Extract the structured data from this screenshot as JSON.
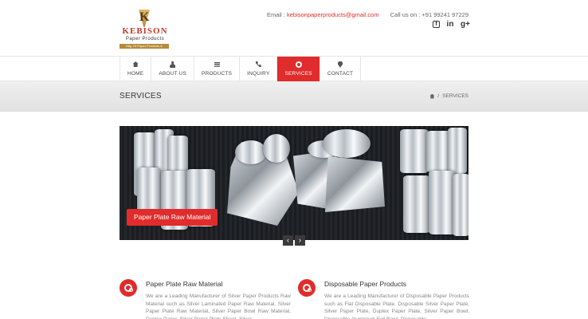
{
  "header": {
    "logo": {
      "name": "KEBISON",
      "tagline": "Paper Products",
      "strip": "Mfg. Of Paper Products & Aluminium"
    },
    "email_label": "Email :",
    "email": "kebisonpaperproducts@gmail.com",
    "call_label": "Call us on :",
    "phone": "+91 99241 97229",
    "social": [
      {
        "icon": "facebook-square-icon",
        "glyph": "f"
      },
      {
        "icon": "linkedin-icon",
        "glyph": "in"
      },
      {
        "icon": "google-plus-icon",
        "glyph": "g+"
      }
    ]
  },
  "nav": {
    "items": [
      {
        "label": "HOME",
        "icon": "home-icon"
      },
      {
        "label": "ABOUT US",
        "icon": "user-icon"
      },
      {
        "label": "PRODUCTS",
        "icon": "list-icon"
      },
      {
        "label": "INQUIRY",
        "icon": "phone-icon"
      },
      {
        "label": "SERVICES",
        "icon": "cogs-icon",
        "active": true
      },
      {
        "label": "CONTACT",
        "icon": "map-marker-icon"
      }
    ]
  },
  "banner": {
    "title": "SERVICES",
    "breadcrumb_sep": "/",
    "breadcrumb_current": "SERVICES"
  },
  "slider": {
    "caption": "Paper Plate Raw Material",
    "prev_glyph": "‹",
    "next_glyph": "›"
  },
  "services": [
    {
      "title": "Paper Plate Raw Material",
      "text": "We are a Leading Manufacturer of Silver Paper Products Raw Material such as Silver Laminated Paper Raw Material, Silver Paper Plate Raw Material, Silver Paper Bowl Raw Material, Duplex Paper, Silver Paper Plate Sheet, Silver"
    },
    {
      "title": "Disposable Paper Products",
      "text": "We are a Leading Manufacturer of Disposable Paper Products such as Flat Disposable Plate, Disposable Silver Paper Plate, Silver Paper Plate, Duplex Paper Plate, Silver Paper Bowl, Disposable Aluminium Foil Bowl, Disposable"
    }
  ],
  "colors": {
    "accent": "#e02c2c",
    "text": "#555555",
    "banner_bg": "#e8e8e8"
  }
}
